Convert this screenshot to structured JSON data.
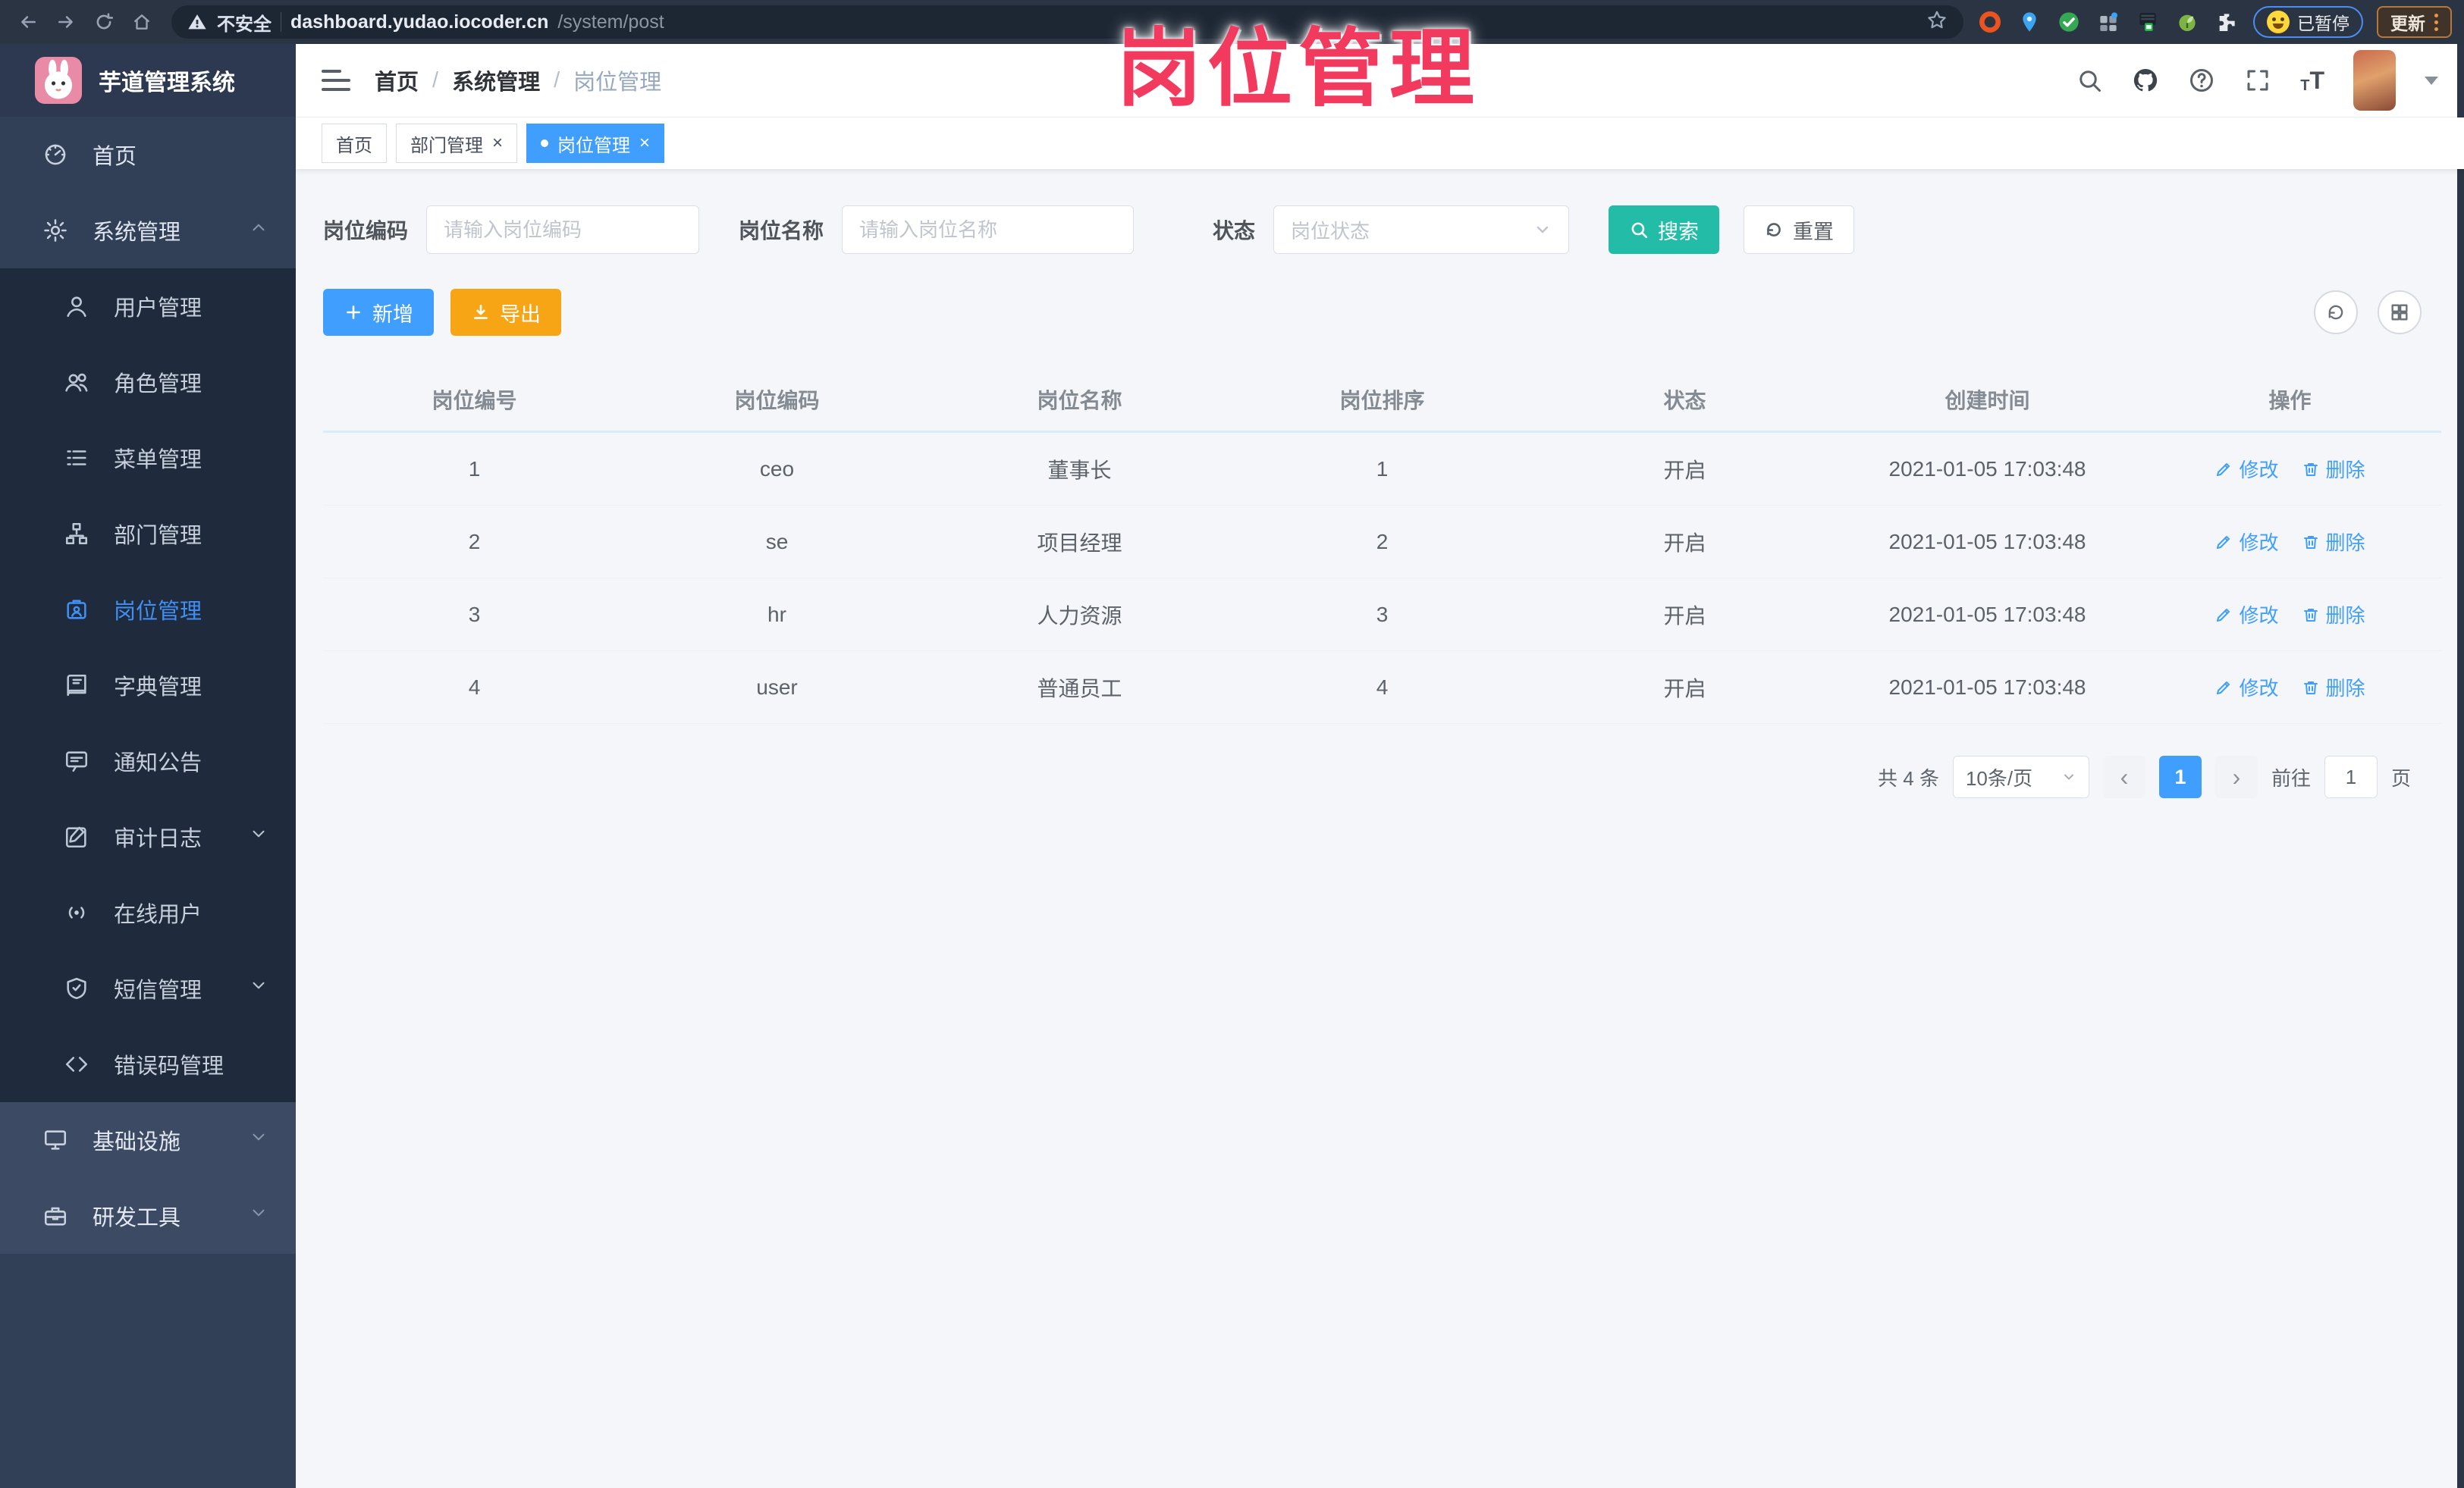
{
  "browser": {
    "security_label": "不安全",
    "url_host": "dashboard.yudao.iocoder.cn",
    "url_path": "/system/post",
    "paused_badge_label": "已暂停",
    "update_button_label": "更新",
    "nav_icons": [
      "back-icon",
      "forward-icon",
      "reload-icon",
      "home-icon"
    ],
    "extension_icons": [
      "bookmark-star-icon",
      "orange-ring-extension",
      "blue-pin-extension",
      "green-check-extension",
      "gray-grid-extension",
      "dark-5g-extension",
      "green-sprout-extension",
      "puzzle-extension"
    ]
  },
  "overlay_title": "岗位管理",
  "sidebar": {
    "app_title": "芋道管理系统",
    "top_items": [
      {
        "label": "首页"
      },
      {
        "label": "系统管理"
      }
    ],
    "system_children": [
      {
        "label": "用户管理"
      },
      {
        "label": "角色管理"
      },
      {
        "label": "菜单管理"
      },
      {
        "label": "部门管理"
      },
      {
        "label": "岗位管理"
      },
      {
        "label": "字典管理"
      },
      {
        "label": "通知公告"
      },
      {
        "label": "审计日志"
      },
      {
        "label": "在线用户"
      },
      {
        "label": "短信管理"
      },
      {
        "label": "错误码管理"
      }
    ],
    "bottom_items": [
      {
        "label": "基础设施"
      },
      {
        "label": "研发工具"
      }
    ]
  },
  "navbar": {
    "breadcrumb": [
      "首页",
      "系统管理",
      "岗位管理"
    ],
    "separator": "/",
    "right_icons": [
      "search-icon",
      "github-icon",
      "help-icon",
      "fullscreen-icon",
      "font-size-icon",
      "avatar",
      "caret-down-icon"
    ],
    "font_size_icon_small": "T",
    "font_size_icon_big": "T"
  },
  "tabs": [
    {
      "label": "首页"
    },
    {
      "label": "部门管理",
      "close": "×"
    },
    {
      "label": "岗位管理",
      "close": "×"
    }
  ],
  "filter": {
    "code_label": "岗位编码",
    "code_placeholder": "请输入岗位编码",
    "name_label": "岗位名称",
    "name_placeholder": "请输入岗位名称",
    "status_label": "状态",
    "status_placeholder": "岗位状态",
    "search_label": "搜索",
    "reset_label": "重置"
  },
  "toolbar": {
    "add_label": "新增",
    "export_label": "导出",
    "right_icons": [
      "refresh-icon",
      "columns-grid-icon"
    ]
  },
  "table": {
    "headers": [
      "岗位编号",
      "岗位编码",
      "岗位名称",
      "岗位排序",
      "状态",
      "创建时间",
      "操作"
    ],
    "rows": [
      {
        "id": "1",
        "code": "ceo",
        "name": "董事长",
        "sort": "1",
        "status": "开启",
        "created": "2021-01-05 17:03:48"
      },
      {
        "id": "2",
        "code": "se",
        "name": "项目经理",
        "sort": "2",
        "status": "开启",
        "created": "2021-01-05 17:03:48"
      },
      {
        "id": "3",
        "code": "hr",
        "name": "人力资源",
        "sort": "3",
        "status": "开启",
        "created": "2021-01-05 17:03:48"
      },
      {
        "id": "4",
        "code": "user",
        "name": "普通员工",
        "sort": "4",
        "status": "开启",
        "created": "2021-01-05 17:03:48"
      }
    ],
    "edit_label": "修改",
    "delete_label": "删除"
  },
  "pagination": {
    "total_label": "共 4 条",
    "page_size_label": "10条/页",
    "prev": "‹",
    "next": "›",
    "current_page": "1",
    "goto_label": "前往",
    "goto_value": "1",
    "page_unit": "页"
  },
  "colors": {
    "primary_blue": "#409eff",
    "search_teal": "#23bda7",
    "export_orange": "#f7a515",
    "overlay_pink": "#f23a5f",
    "sidebar_bg": "#313f57",
    "submenu_bg": "#1f2b3c"
  }
}
